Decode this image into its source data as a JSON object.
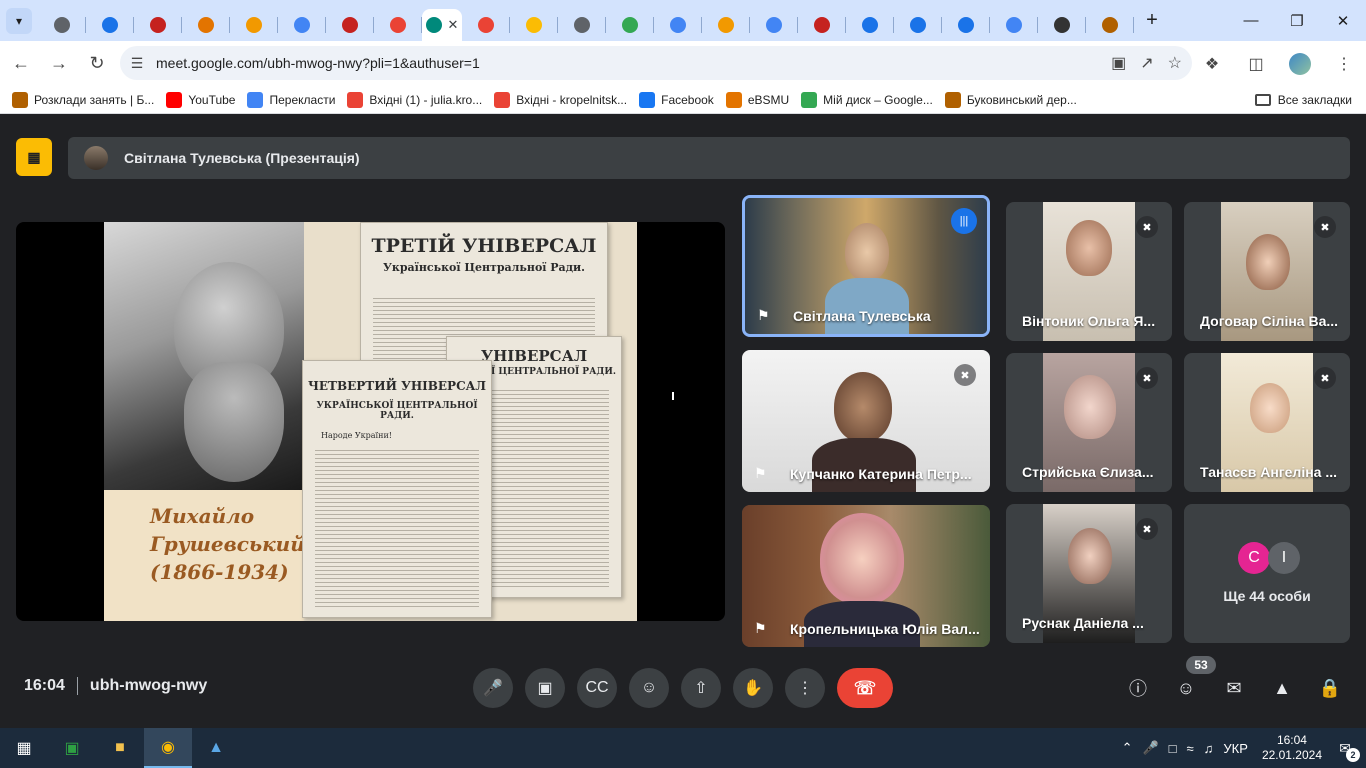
{
  "browser": {
    "tab_search_icon": "chevron-down-icon",
    "tabs": [
      {
        "icon": "chrome-icon",
        "color": "#5f6368"
      },
      {
        "icon": "globe-icon",
        "color": "#1a73e8"
      },
      {
        "icon": "shield-icon",
        "color": "#c5221f"
      },
      {
        "icon": "sync-icon",
        "color": "#e37400"
      },
      {
        "icon": "link-icon",
        "color": "#f29900"
      },
      {
        "icon": "google-icon",
        "color": "#4285f4"
      },
      {
        "icon": "tag-icon",
        "color": "#c5221f"
      },
      {
        "icon": "gmail-icon",
        "color": "#ea4335"
      },
      {
        "icon": "meet-icon",
        "color": "#ffffff",
        "active": true
      },
      {
        "icon": "gmail-icon",
        "color": "#ea4335"
      },
      {
        "icon": "drive-icon",
        "color": "#fbbc04"
      },
      {
        "icon": "globe-icon",
        "color": "#5f6368"
      },
      {
        "icon": "fruit-icon",
        "color": "#34a853"
      },
      {
        "icon": "google-icon",
        "color": "#4285f4"
      },
      {
        "icon": "link-icon",
        "color": "#f29900"
      },
      {
        "icon": "google-icon",
        "color": "#4285f4"
      },
      {
        "icon": "sn-icon",
        "color": "#c5221f"
      },
      {
        "icon": "translate-icon",
        "color": "#1a73e8"
      },
      {
        "icon": "app-icon",
        "color": "#1a73e8"
      },
      {
        "icon": "app-icon",
        "color": "#1a73e8"
      },
      {
        "icon": "google-icon",
        "color": "#4285f4"
      },
      {
        "icon": "e-icon",
        "color": "#333333"
      },
      {
        "icon": "building-icon",
        "color": "#b06000"
      }
    ],
    "url": "meet.google.com/ubh-mwog-nwy?pli=1&authuser=1",
    "bookmarks": [
      {
        "label": "Розклади занять | Б...",
        "icon": "building-icon",
        "color": "#b06000"
      },
      {
        "label": "YouTube",
        "icon": "youtube-icon",
        "color": "#ff0000"
      },
      {
        "label": "Перекласти",
        "icon": "translate-icon",
        "color": "#4285f4"
      },
      {
        "label": "Вхідні (1) - julia.kro...",
        "icon": "gmail-icon",
        "color": "#ea4335"
      },
      {
        "label": "Вхідні - kropelnitsk...",
        "icon": "gmail-icon",
        "color": "#ea4335"
      },
      {
        "label": "Facebook",
        "icon": "facebook-icon",
        "color": "#1877f2"
      },
      {
        "label": "eBSMU",
        "icon": "ebsmu-icon",
        "color": "#e37400"
      },
      {
        "label": "Мій диск – Google...",
        "icon": "drive-icon",
        "color": "#34a853"
      },
      {
        "label": "Буковинський дер...",
        "icon": "building-icon",
        "color": "#b06000"
      }
    ],
    "all_bookmarks": "Все закладки"
  },
  "meet": {
    "presenting_banner": "Світлана Тулевська (Презентація)",
    "slide": {
      "doc1_title_line1": "ТРЕТІЙ УНІВЕРСАЛ",
      "doc1_title_line2": "Української Центральної Ради.",
      "doc2_title_line1": "УНІВЕРСАЛ",
      "doc2_title_line2": "НСЬКОЇ ЦЕНТРАЛЬНОЇ РАДИ.",
      "doc3_title_line1": "ЧЕТВЕРТИЙ УНІВЕРСАЛ",
      "doc3_title_line2": "УКРАЇНСЬКОЇ ЦЕНТРАЛЬНОЇ РАДИ.",
      "doc3_greeting": "Народе України!",
      "caption_line1": "Михайло",
      "caption_line2": "Грушевський",
      "caption_line3": "(1866-1934)"
    },
    "participants_main": [
      {
        "name": "Світлана Тулевська",
        "pinned": true,
        "speaking": true
      },
      {
        "name": "Купчанко Катерина Петр...",
        "pinned": true,
        "muted": true
      },
      {
        "name": "Кропельницька Юлія Вал...",
        "pinned": true
      }
    ],
    "participants_small": [
      {
        "name": "Вінтоник Ольга Я...",
        "muted": true
      },
      {
        "name": "Договар Сіліна Ва...",
        "muted": true
      },
      {
        "name": "Стрийська Єлиза...",
        "muted": true
      },
      {
        "name": "Танасєв Ангеліна ...",
        "muted": true
      },
      {
        "name": "Руснак Даніела ...",
        "muted": true
      }
    ],
    "more": {
      "avatars": [
        {
          "letter": "С",
          "color": "#e52592"
        },
        {
          "letter": "І",
          "color": "#5f6368"
        }
      ],
      "label": "Ще 44 особи"
    },
    "time": "16:04",
    "meeting_code": "ubh-mwog-nwy",
    "participant_count": "53"
  },
  "taskbar": {
    "language": "УКР",
    "time": "16:04",
    "date": "22.01.2024",
    "notifications": "2"
  }
}
